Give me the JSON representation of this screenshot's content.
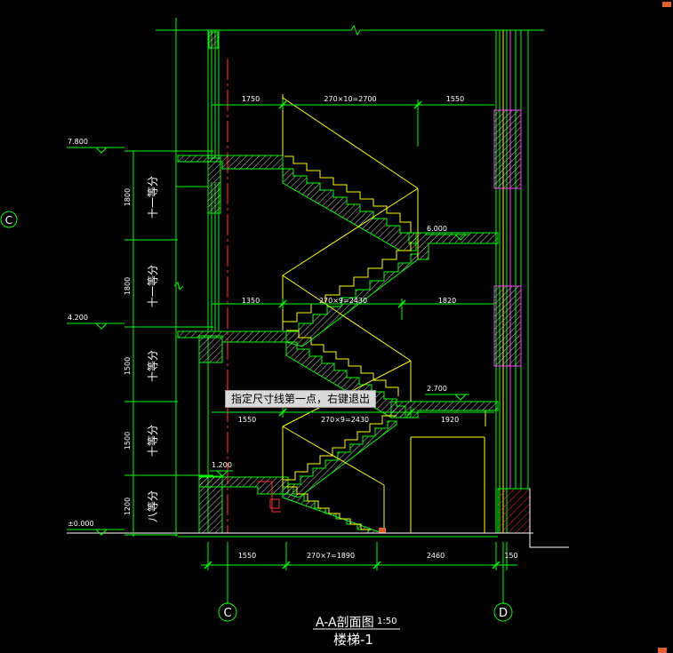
{
  "tooltip": "指定尺寸线第一点，右键退出",
  "title": {
    "section": "A-A剖面图",
    "scale": "1:50",
    "name": "楼梯-1"
  },
  "axes": {
    "left_grid": "C",
    "right_grid": "D",
    "side_grid": "C"
  },
  "levels": {
    "l0": "±0.000",
    "l1": "1.200",
    "l2": "2.700",
    "l3": "4.200",
    "l4": "6.000",
    "l5": "7.800"
  },
  "dims_horizontal": {
    "top_left": "1750",
    "top_mid": "270×10=2700",
    "top_right": "1550",
    "mid_left": "1350",
    "mid_mid": "270×9=2430",
    "mid_right": "1820",
    "low_left": "1550",
    "low_mid": "270×9=2430",
    "low_right": "1920",
    "bot_left": "1550",
    "bot_mid": "270×7=1890",
    "bot_right": "2460",
    "bot_end": "150"
  },
  "dims_vertical": {
    "v1": "1800",
    "v2": "1800",
    "v3": "1500",
    "v4": "1500",
    "v5": "1200"
  },
  "divisions": {
    "d1": "十一等分",
    "d2": "十一等分",
    "d3": "十等分",
    "d4": "十等分",
    "d5": "八等分"
  },
  "colors": {
    "green": "#00ff00",
    "yellow": "#ffff00",
    "red": "#ff2020",
    "cyan": "#00c8ff",
    "magenta": "#ff40ff",
    "white": "#ffffff",
    "hatch": "#c0c0c0"
  }
}
